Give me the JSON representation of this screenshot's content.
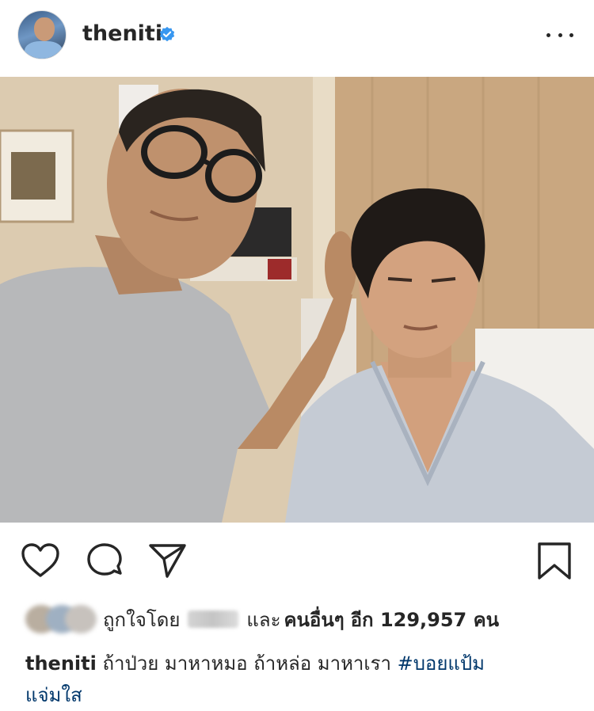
{
  "post": {
    "username": "theniti",
    "verified": true,
    "likes_prefix": "ถูกใจโดย",
    "likes_and": "และ",
    "likes_others": "คนอื่นๆ",
    "likes_more": "อีก 129,957 คน",
    "caption_text": "ถ้าป่วย มาหาหมอ ถ้าหล่อ มาหาเรา",
    "hashtag": "#บอยแป้ม",
    "caption_line2": "แจ่มใส"
  },
  "icons": {
    "like": "heart-icon",
    "comment": "comment-icon",
    "share": "paper-plane-icon",
    "save": "bookmark-icon",
    "more": "more-options-icon",
    "verified": "verified-badge-icon"
  },
  "colors": {
    "text": "#262626",
    "hashtag": "#00376b",
    "verified": "#3897f0"
  }
}
